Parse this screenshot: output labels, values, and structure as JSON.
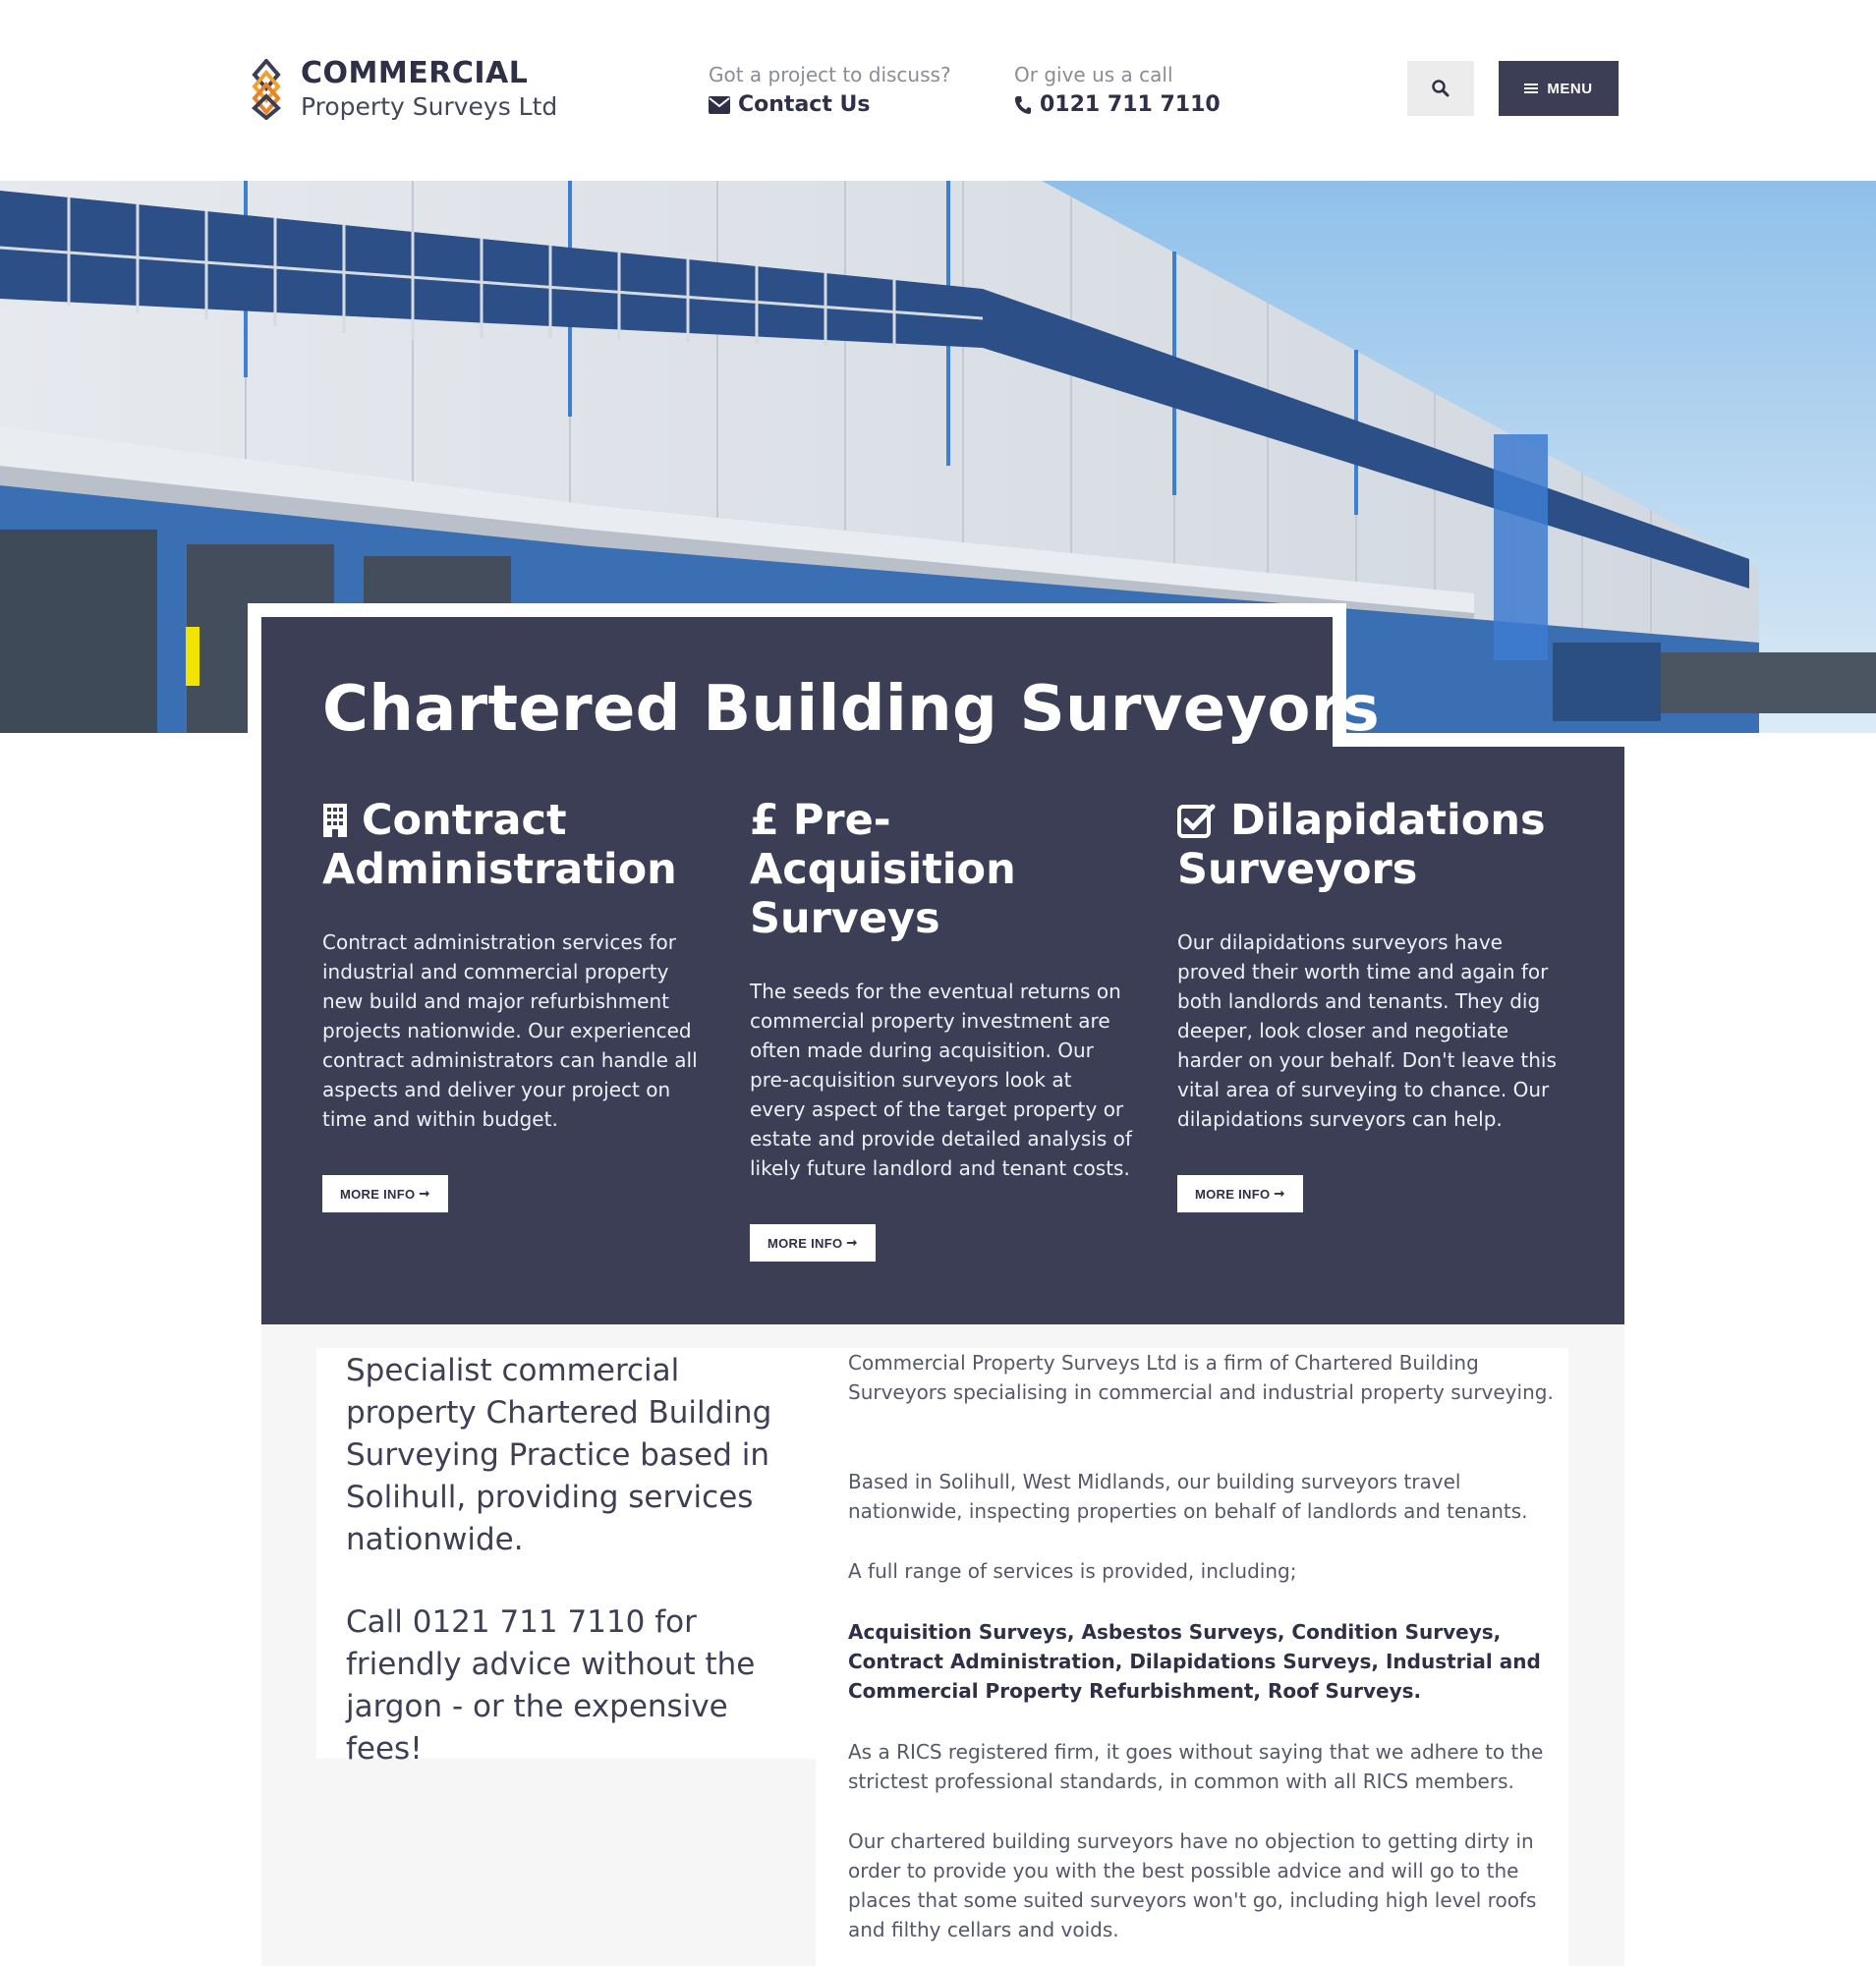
{
  "header": {
    "logo_line1": "COMMERCIAL",
    "logo_line2": "Property Surveys Ltd",
    "project_prompt": "Got a project to discuss?",
    "contact_label": "Contact Us",
    "call_prompt": "Or give us a call",
    "phone": "0121 711 7110",
    "menu_label": "MENU",
    "icons": [
      "envelope-icon",
      "phone-icon",
      "search-icon",
      "menu-icon"
    ]
  },
  "hero": {
    "title": "Chartered Building Surveyors"
  },
  "services": [
    {
      "icon": "building-icon",
      "title": "Contract Administration",
      "body": "Contract administration services for industrial and commercial property new build and major refurbishment projects nationwide. Our experienced contract administrators can handle all aspects and deliver your project on time and within budget.",
      "button": "MORE INFO"
    },
    {
      "icon": "pound-icon",
      "title": "Pre-Acquisition Surveys",
      "body": "The seeds for the eventual returns on commercial property investment are often made during acquisition. Our pre-acquisition surveyors look at every aspect of the target property or estate and provide detailed analysis of likely future landlord and tenant costs.",
      "button": "MORE INFO"
    },
    {
      "icon": "check-square-icon",
      "title": "Dilapidations Surveyors",
      "body": "Our dilapidations surveyors have proved their worth time and again for both landlords and tenants. They dig deeper, look closer and negotiate harder on your behalf. Don't leave this vital area of surveying to chance. Our dilapidations surveyors can help.",
      "button": "MORE INFO"
    }
  ],
  "intro": {
    "lead": "Specialist commercial property Chartered Building Surveying Practice based in Solihull, providing services nationwide.",
    "call": "Call 0121 711 7110 for friendly advice without the jargon - or the expensive fees!",
    "paragraphs": [
      "Commercial Property Surveys Ltd is a firm of Chartered Building Surveyors specialising in commercial and industrial property surveying.",
      "Based in Solihull, West Midlands, our building surveyors travel nationwide, inspecting properties on behalf of landlords and tenants.",
      "A full range of services is provided, including;",
      "Acquisition Surveys, Asbestos Surveys, Condition Surveys, Contract Administration, Dilapidations Surveys, Industrial and Commercial Property Refurbishment, Roof Surveys.",
      "As a RICS registered firm, it goes without saying that we adhere to the strictest professional standards, in common with all RICS members.",
      "Our chartered  building surveyors have no objection to getting dirty in order to provide you with the best possible advice and will go to the places that some suited surveyors won't go, including high level roofs and filthy cellars and voids."
    ]
  },
  "colors": {
    "panel": "#3b3e55",
    "logo_orange": "#f0a030",
    "logo_dark": "#3b3e55",
    "text_dark": "#2e3047"
  }
}
